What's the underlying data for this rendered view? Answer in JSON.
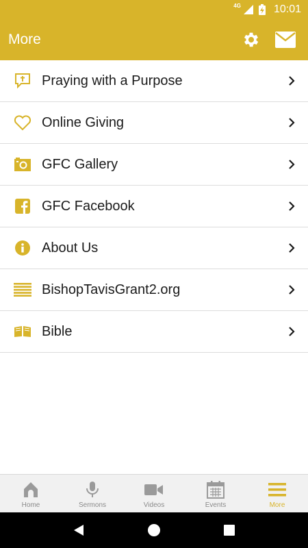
{
  "status_bar": {
    "network": "4G",
    "time": "10:01"
  },
  "app_bar": {
    "title": "More",
    "actions": [
      {
        "icon": "gear-icon"
      },
      {
        "icon": "envelope-icon"
      }
    ]
  },
  "menu": {
    "items": [
      {
        "label": "Praying with a Purpose",
        "icon": "prayer-chat-icon"
      },
      {
        "label": "Online Giving",
        "icon": "heart-icon"
      },
      {
        "label": "GFC Gallery",
        "icon": "camera-icon"
      },
      {
        "label": "GFC Facebook",
        "icon": "facebook-icon"
      },
      {
        "label": "About Us",
        "icon": "info-icon"
      },
      {
        "label": "BishopTavisGrant2.org",
        "icon": "lines-icon"
      },
      {
        "label": "Bible",
        "icon": "open-book-icon"
      }
    ]
  },
  "tabs": {
    "items": [
      {
        "label": "Home",
        "icon": "church-icon",
        "active": false
      },
      {
        "label": "Sermons",
        "icon": "microphone-icon",
        "active": false
      },
      {
        "label": "Videos",
        "icon": "video-camera-icon",
        "active": false
      },
      {
        "label": "Events",
        "icon": "calendar-icon",
        "active": false
      },
      {
        "label": "More",
        "icon": "hamburger-icon",
        "active": true
      }
    ]
  },
  "colors": {
    "accent": "#d8b42a",
    "tab_inactive": "#8a8a8a",
    "text": "#1a1a1a"
  }
}
